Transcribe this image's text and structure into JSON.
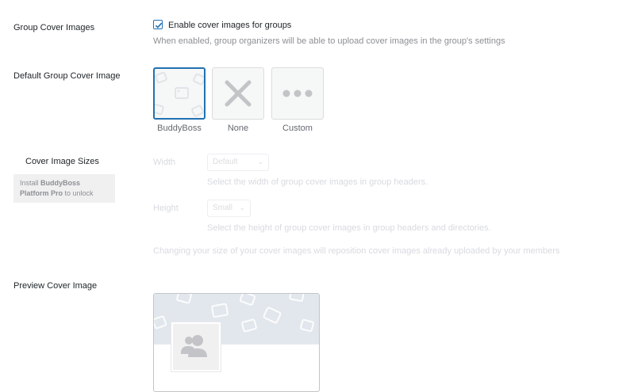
{
  "group_cover_images": {
    "label": "Group Cover Images",
    "checkbox_label": "Enable cover images for groups",
    "checked": true,
    "help": "When enabled, group organizers will be able to upload cover images in the group's settings"
  },
  "default_cover": {
    "label": "Default Group Cover Image",
    "options": [
      {
        "label": "BuddyBoss",
        "selected": true,
        "icon": "image-pattern-icon"
      },
      {
        "label": "None",
        "selected": false,
        "icon": "x-icon"
      },
      {
        "label": "Custom",
        "selected": false,
        "icon": "ellipsis-icon"
      }
    ]
  },
  "cover_sizes": {
    "label": "Cover Image Sizes",
    "pro_notice_prefix": "Install ",
    "pro_notice_bold": "BuddyBoss Platform Pro",
    "pro_notice_suffix": " to unlock",
    "width_label": "Width",
    "width_value": "Default",
    "width_help": "Select the width of group cover images in group headers.",
    "height_label": "Height",
    "height_value": "Small",
    "height_help": "Select the height of group cover images in group headers and directories.",
    "note": "Changing your size of your cover images will reposition cover images already uploaded by your members"
  },
  "preview": {
    "label": "Preview Cover Image",
    "avatar_icon": "group-avatar-icon",
    "colors": {
      "banner": "#e2e7ed",
      "accent": "#2271b1"
    }
  }
}
